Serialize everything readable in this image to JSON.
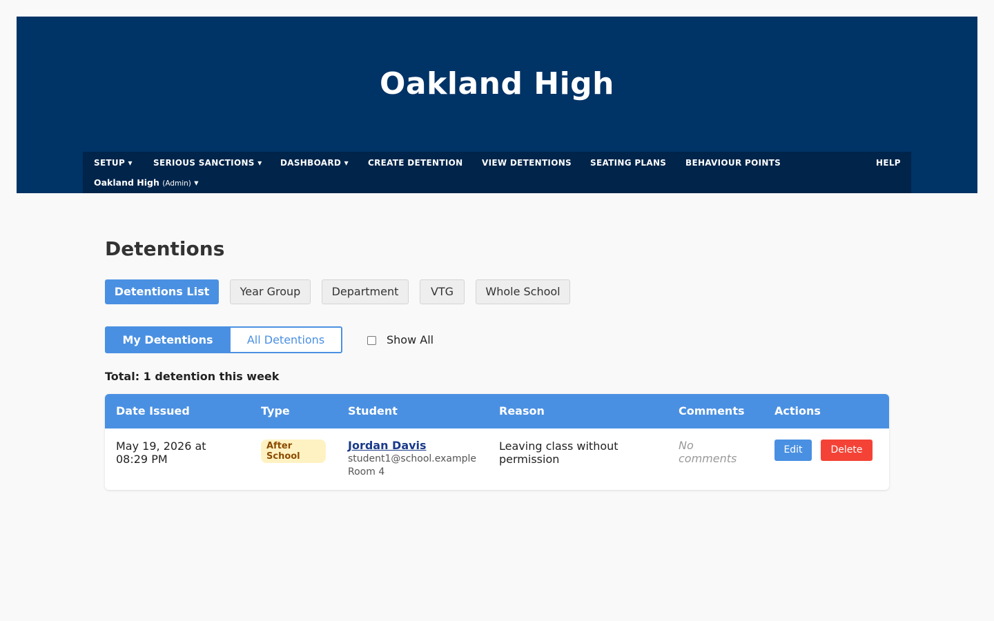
{
  "header": {
    "school_title": "Oakland High"
  },
  "nav": {
    "items": [
      {
        "label": "SETUP ▾"
      },
      {
        "label": "SERIOUS SANCTIONS ▾"
      },
      {
        "label": "DASHBOARD ▾"
      },
      {
        "label": "CREATE DETENTION"
      },
      {
        "label": "VIEW DETENTIONS"
      },
      {
        "label": "SEATING PLANS"
      },
      {
        "label": "BEHAVIOUR POINTS"
      },
      {
        "label": "HELP"
      }
    ],
    "school_menu": {
      "name": "Oakland High",
      "role": "(Admin)",
      "caret": "▾"
    }
  },
  "main": {
    "heading": "Detentions",
    "tabs": [
      {
        "label": "Detentions List",
        "active": true
      },
      {
        "label": "Year Group",
        "active": false
      },
      {
        "label": "Department",
        "active": false
      },
      {
        "label": "VTG",
        "active": false
      },
      {
        "label": "Whole School",
        "active": false
      }
    ],
    "scope_toggle": {
      "mine": "My Detentions",
      "all": "All Detentions",
      "selected": "My Detentions"
    },
    "show_all": {
      "label": "Show All",
      "checked": false
    },
    "total_text": "Total: 1 detention this week"
  },
  "table": {
    "headers": [
      "Date Issued",
      "Type",
      "Student",
      "Reason",
      "Comments",
      "Actions"
    ],
    "rows": [
      {
        "date_line1": "May 19, 2026 at",
        "date_line2": "08:29 PM",
        "type_line1": "After",
        "type_line2": "School",
        "student_name": "Jordan Davis",
        "student_email": "student1@school.example",
        "student_room": "Room 4",
        "reason_line1": "Leaving class without",
        "reason_line2": "permission",
        "comments_line1": "No",
        "comments_line2": "comments",
        "edit_label": "Edit",
        "delete_label": "Delete"
      }
    ]
  },
  "colors": {
    "banner": "#003366",
    "navbar": "#00244a",
    "accent": "#4a90e2",
    "danger": "#f44336",
    "badge_bg": "#fff2c2",
    "badge_text": "#8a4b00"
  }
}
